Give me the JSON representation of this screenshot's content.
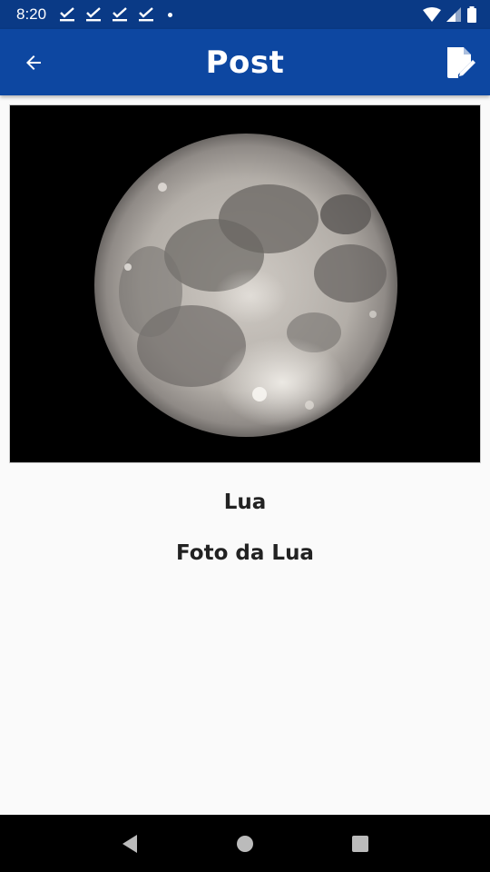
{
  "status_bar": {
    "time": "8:20",
    "notification_icons": [
      "download-done-icon",
      "download-done-icon",
      "download-done-icon",
      "download-done-icon"
    ],
    "system_icons": [
      "wifi-icon",
      "cell-signal-icon",
      "battery-icon"
    ]
  },
  "app_bar": {
    "title": "Post",
    "color": "#0d47a1",
    "back_icon": "arrow-back-icon",
    "edit_icon": "edit-note-icon"
  },
  "post": {
    "image_alt": "moon-photo",
    "title": "Lua",
    "description": "Foto da Lua"
  },
  "nav_bar": {
    "icons": [
      "back-triangle-icon",
      "home-circle-icon",
      "recents-square-icon"
    ]
  }
}
